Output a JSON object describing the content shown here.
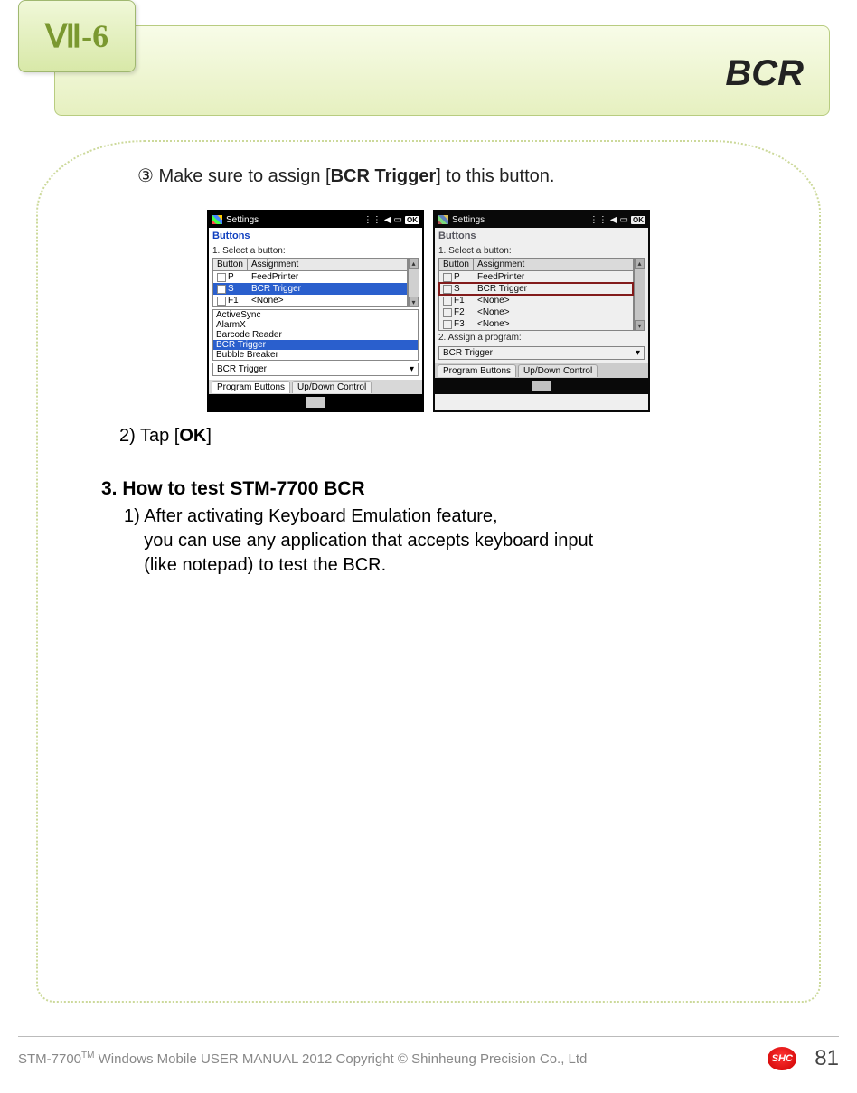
{
  "chapter": "Ⅶ-6",
  "title": "BCR",
  "step3": {
    "marker": "③",
    "pre": " Make sure to assign [",
    "bold": "BCR Trigger",
    "post": "] to this button."
  },
  "screens": {
    "common": {
      "taskbar_title": "Settings",
      "ok": "OK",
      "sec_title": "Buttons",
      "label1": "1. Select a button:",
      "hdr_button": "Button",
      "hdr_assign": "Assignment",
      "tab_program": "Program Buttons",
      "tab_updown": "Up/Down Control"
    },
    "left": {
      "rows": [
        {
          "btn": "P",
          "assign": "FeedPrinter"
        },
        {
          "btn": "S",
          "assign": "BCR Trigger",
          "sel": true
        },
        {
          "btn": "F1",
          "assign": "<None>"
        }
      ],
      "dropdown": [
        "ActiveSync",
        "AlarmX",
        "Barcode Reader",
        "BCR Trigger",
        "Bubble Breaker"
      ],
      "dropdown_sel": "BCR Trigger",
      "combo": "BCR Trigger"
    },
    "right": {
      "rows": [
        {
          "btn": "P",
          "assign": "FeedPrinter"
        },
        {
          "btn": "S",
          "assign": "BCR Trigger",
          "hl": true
        },
        {
          "btn": "F1",
          "assign": "<None>"
        },
        {
          "btn": "F2",
          "assign": "<None>"
        },
        {
          "btn": "F3",
          "assign": "<None>"
        }
      ],
      "label2": "2. Assign a program:",
      "combo": "BCR Trigger"
    }
  },
  "step2": {
    "pre": "2) Tap [",
    "bold": "OK",
    "post": "]"
  },
  "section3": {
    "heading": "3. How to test STM-7700 BCR",
    "line1": "1) After activating Keyboard Emulation feature,",
    "line2": "you can use any application that accepts keyboard input",
    "line3": "(like notepad) to test the BCR."
  },
  "footer": {
    "product": "STM-7700",
    "tm": "TM",
    "text": " Windows Mobile USER MANUAL  2012 Copyright © Shinheung Precision Co., Ltd",
    "logo": "SHC",
    "page": "81"
  }
}
